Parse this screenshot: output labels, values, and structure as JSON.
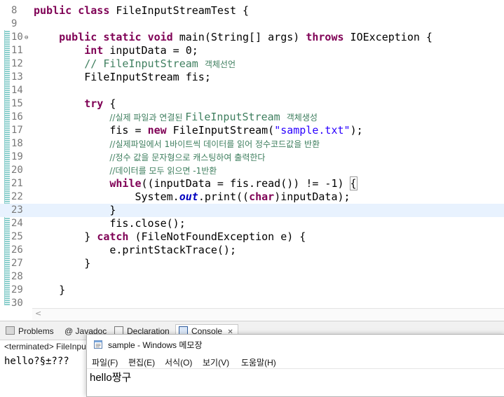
{
  "editor": {
    "current_line": 23,
    "lines": [
      {
        "n": "8",
        "segs": [
          {
            "c": "kw",
            "t": "public"
          },
          {
            "t": " "
          },
          {
            "c": "kw",
            "t": "class"
          },
          {
            "t": " FileInputStreamTest {"
          }
        ]
      },
      {
        "n": "9",
        "segs": []
      },
      {
        "n": "10",
        "fold": "⊖",
        "segs": [
          {
            "t": "    "
          },
          {
            "c": "kw",
            "t": "public"
          },
          {
            "t": " "
          },
          {
            "c": "kw",
            "t": "static"
          },
          {
            "t": " "
          },
          {
            "c": "kw",
            "t": "void"
          },
          {
            "t": " main(String[] args) "
          },
          {
            "c": "kw",
            "t": "throws"
          },
          {
            "t": " IOException {"
          }
        ]
      },
      {
        "n": "11",
        "segs": [
          {
            "t": "        "
          },
          {
            "c": "kw",
            "t": "int"
          },
          {
            "t": " inputData = 0;"
          }
        ]
      },
      {
        "n": "12",
        "segs": [
          {
            "t": "        "
          },
          {
            "c": "cm",
            "t": "// FileInputStream "
          },
          {
            "c": "cm cmk",
            "t": "객체선언"
          }
        ]
      },
      {
        "n": "13",
        "segs": [
          {
            "t": "        FileInputStream fis;"
          }
        ]
      },
      {
        "n": "14",
        "segs": []
      },
      {
        "n": "15",
        "segs": [
          {
            "t": "        "
          },
          {
            "c": "kw",
            "t": "try"
          },
          {
            "t": " {"
          }
        ]
      },
      {
        "n": "16",
        "segs": [
          {
            "t": "            "
          },
          {
            "c": "cm cmk",
            "t": "//실제 파일과 연결된 "
          },
          {
            "c": "cm",
            "t": "FileInputStream "
          },
          {
            "c": "cm cmk",
            "t": "객체생성"
          }
        ]
      },
      {
        "n": "17",
        "segs": [
          {
            "t": "            fis = "
          },
          {
            "c": "kw",
            "t": "new"
          },
          {
            "t": " FileInputStream("
          },
          {
            "c": "st",
            "t": "\"sample.txt\""
          },
          {
            "t": ");"
          }
        ]
      },
      {
        "n": "18",
        "segs": [
          {
            "t": "            "
          },
          {
            "c": "cm cmk",
            "t": "//실제파일에서 1바이트씩 데이터를 읽어 정수코드값을 반환"
          }
        ]
      },
      {
        "n": "19",
        "segs": [
          {
            "t": "            "
          },
          {
            "c": "cm cmk",
            "t": "//정수 값을 문자형으로 캐스팅하여 출력한다"
          }
        ]
      },
      {
        "n": "20",
        "segs": [
          {
            "t": "            "
          },
          {
            "c": "cm cmk",
            "t": "//데이터를 모두 읽으면 -1반환"
          }
        ]
      },
      {
        "n": "21",
        "segs": [
          {
            "t": "            "
          },
          {
            "c": "kw",
            "t": "while"
          },
          {
            "t": "((inputData = fis.read()) != -1) "
          },
          {
            "c": "bx",
            "t": "{"
          }
        ]
      },
      {
        "n": "22",
        "segs": [
          {
            "t": "                System."
          },
          {
            "c": "fi",
            "t": "out"
          },
          {
            "t": ".print(("
          },
          {
            "c": "kw",
            "t": "char"
          },
          {
            "t": ")inputData);"
          }
        ]
      },
      {
        "n": "23",
        "segs": [
          {
            "t": "            }"
          }
        ]
      },
      {
        "n": "24",
        "segs": [
          {
            "t": "            fis.close();"
          }
        ]
      },
      {
        "n": "25",
        "segs": [
          {
            "t": "        } "
          },
          {
            "c": "kw",
            "t": "catch"
          },
          {
            "t": " (FileNotFoundException e) {"
          }
        ]
      },
      {
        "n": "26",
        "segs": [
          {
            "t": "            e.printStackTrace();"
          }
        ]
      },
      {
        "n": "27",
        "segs": [
          {
            "t": "        }"
          }
        ]
      },
      {
        "n": "28",
        "segs": []
      },
      {
        "n": "29",
        "segs": [
          {
            "t": "    }"
          }
        ]
      },
      {
        "n": "30",
        "segs": []
      }
    ],
    "scroll_left": "<"
  },
  "panel": {
    "tabs": [
      {
        "label": "Problems",
        "icon": "problems-icon"
      },
      {
        "label": "@ Javadoc",
        "icon": "javadoc-icon"
      },
      {
        "label": "Declaration",
        "icon": "declaration-icon"
      },
      {
        "label": "Console",
        "icon": "console-icon",
        "close": "✕"
      }
    ],
    "console_header": "<terminated> FileInpu",
    "console_output": "hello?§±???"
  },
  "notepad": {
    "title": "sample - Windows 메모장",
    "menu": [
      "파일(F)",
      "편집(E)",
      "서식(O)",
      "보기(V)",
      "도움말(H)"
    ],
    "content": "hello짱구"
  }
}
